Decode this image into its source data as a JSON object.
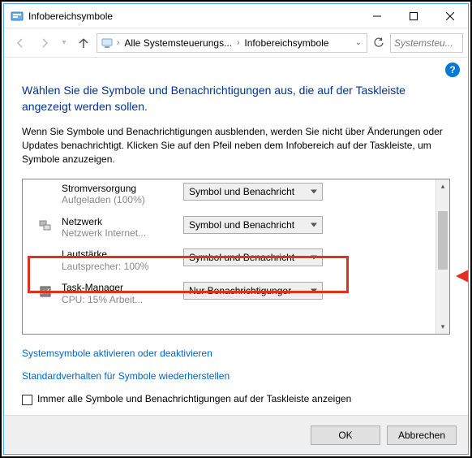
{
  "window": {
    "title": "Infobereichsymbole"
  },
  "breadcrumb": {
    "seg1": "Alle Systemsteuerungs...",
    "seg2": "Infobereichsymbole"
  },
  "search": {
    "placeholder": "Systemsteu..."
  },
  "heading": "Wählen Sie die Symbole und Benachrichtigungen aus, die auf der Taskleiste angezeigt werden sollen.",
  "description": "Wenn Sie Symbole und Benachrichtigungen ausblenden, werden Sie nicht über Änderungen oder Updates benachrichtigt. Klicken Sie auf den Pfeil neben dem Infobereich auf der Taskleiste, um Symbole anzuzeigen.",
  "items": [
    {
      "name": "Stromversorgung",
      "sub": "Aufgeladen (100%)",
      "value": "Symbol und Benachricht"
    },
    {
      "name": "Netzwerk",
      "sub": "Netzwerk Internet...",
      "value": "Symbol und Benachricht"
    },
    {
      "name": "Lautstärke",
      "sub": "Lautsprecher: 100%",
      "value": "Symbol und Benachricht"
    },
    {
      "name": "Task-Manager",
      "sub": "CPU: 15%   Arbeit...",
      "value": "Nur Benachrichtigunger"
    }
  ],
  "links": {
    "sysicons": "Systemsymbole aktivieren oder deaktivieren",
    "restore": "Standardverhalten für Symbole wiederherstellen"
  },
  "checkbox": {
    "label": "Immer alle Symbole und Benachrichtigungen auf der Taskleiste anzeigen"
  },
  "buttons": {
    "ok": "OK",
    "cancel": "Abbrechen"
  }
}
